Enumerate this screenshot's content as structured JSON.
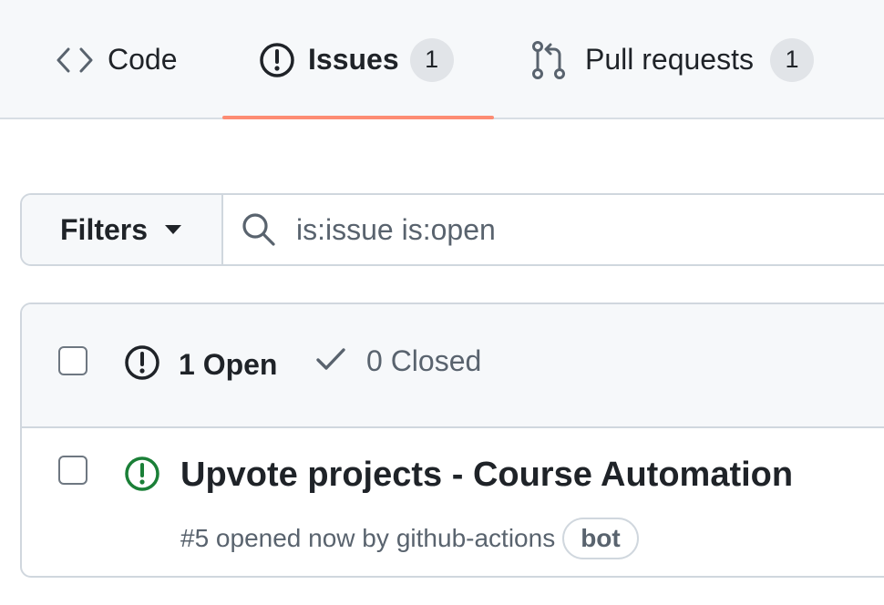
{
  "nav": {
    "tabs": [
      {
        "label": "Code",
        "icon": "code-icon"
      },
      {
        "label": "Issues",
        "icon": "issue-opened-icon",
        "count": "1",
        "selected": true
      },
      {
        "label": "Pull requests",
        "icon": "git-pull-request-icon",
        "count": "1"
      }
    ]
  },
  "filters": {
    "button_label": "Filters",
    "search_value": "is:issue is:open"
  },
  "issues": {
    "open_label": "1 Open",
    "closed_label": "0 Closed",
    "items": [
      {
        "title": "Upvote projects - Course Automation",
        "meta_prefix": "#5 opened now by",
        "author": "github-actions",
        "badge": "bot"
      }
    ]
  },
  "colors": {
    "accent_underline": "#fd8c73",
    "open_green": "#1a7f37",
    "nav_bg": "#f6f8fa",
    "border": "#d0d7de"
  }
}
